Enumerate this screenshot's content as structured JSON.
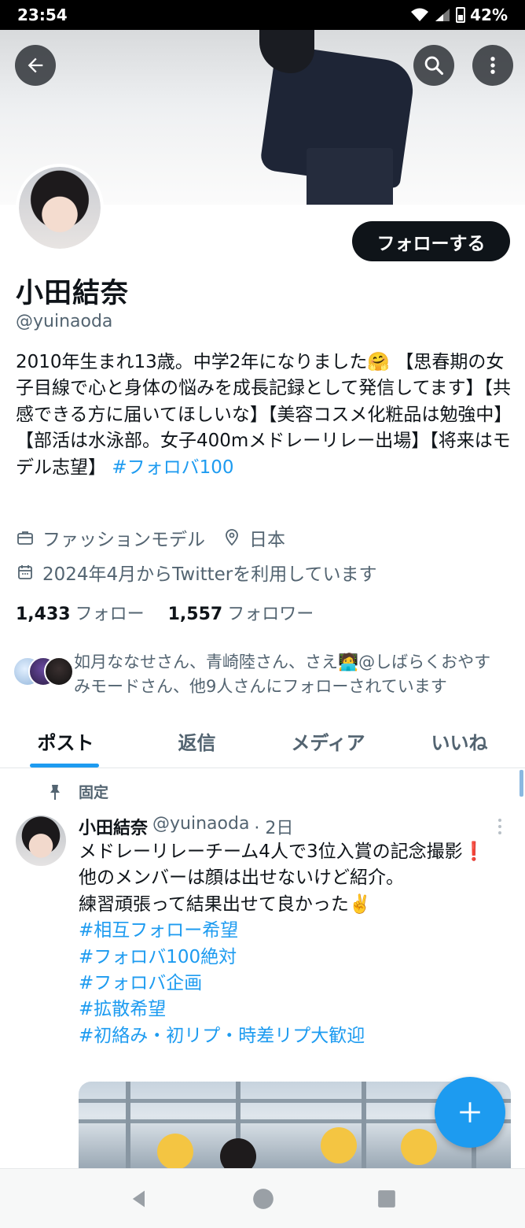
{
  "status_bar": {
    "time": "23:54",
    "battery": "42%"
  },
  "profile": {
    "name": "小田結奈",
    "handle": "@yuinaoda",
    "follow_button": "フォローする",
    "bio_text": "2010年生まれ13歳。中学2年になりました🤗 【思春期の女子目線で心と身体の悩みを成長記録として発信してます】【共感できる方に届いてほしいな】【美容コスメ化粧品は勉強中】【部活は水泳部。女子400mメドレーリレー出場】【将来はモデル志望】",
    "bio_hashtag": "#フォロバ100",
    "profession": "ファッションモデル",
    "location": "日本",
    "joined": "2024年4月からTwitterを利用しています",
    "following_count": "1,433",
    "following_label": "フォロー",
    "followers_count": "1,557",
    "followers_label": "フォロワー",
    "followed_by": "如月ななせさん、青崎陸さん、さえ🧑‍💻@しばらくおやすみモードさん、他9人さんにフォローされています"
  },
  "tabs": [
    {
      "label": "ポスト"
    },
    {
      "label": "返信"
    },
    {
      "label": "メディア"
    },
    {
      "label": "いいね"
    }
  ],
  "pinned_post": {
    "pinned_label": "固定",
    "author_name": "小田結奈",
    "author_handle": "@yuinaoda",
    "time": "· 2日",
    "line1": "メドレーリレーチーム4人で3位入賞の記念撮影❗️",
    "line2": "他のメンバーは顔は出せないけど紹介。",
    "line3": "練習頑張って結果出せて良かった✌️",
    "hashtags": [
      "#相互フォロー希望",
      "#フォロバ100絶対",
      "#フォロバ企画",
      "#拡散希望",
      "#初絡み・初リプ・時差リプ大歓迎"
    ]
  },
  "colors": {
    "accent": "#1d9bf0",
    "text": "#0f1419",
    "secondary": "#536471"
  }
}
